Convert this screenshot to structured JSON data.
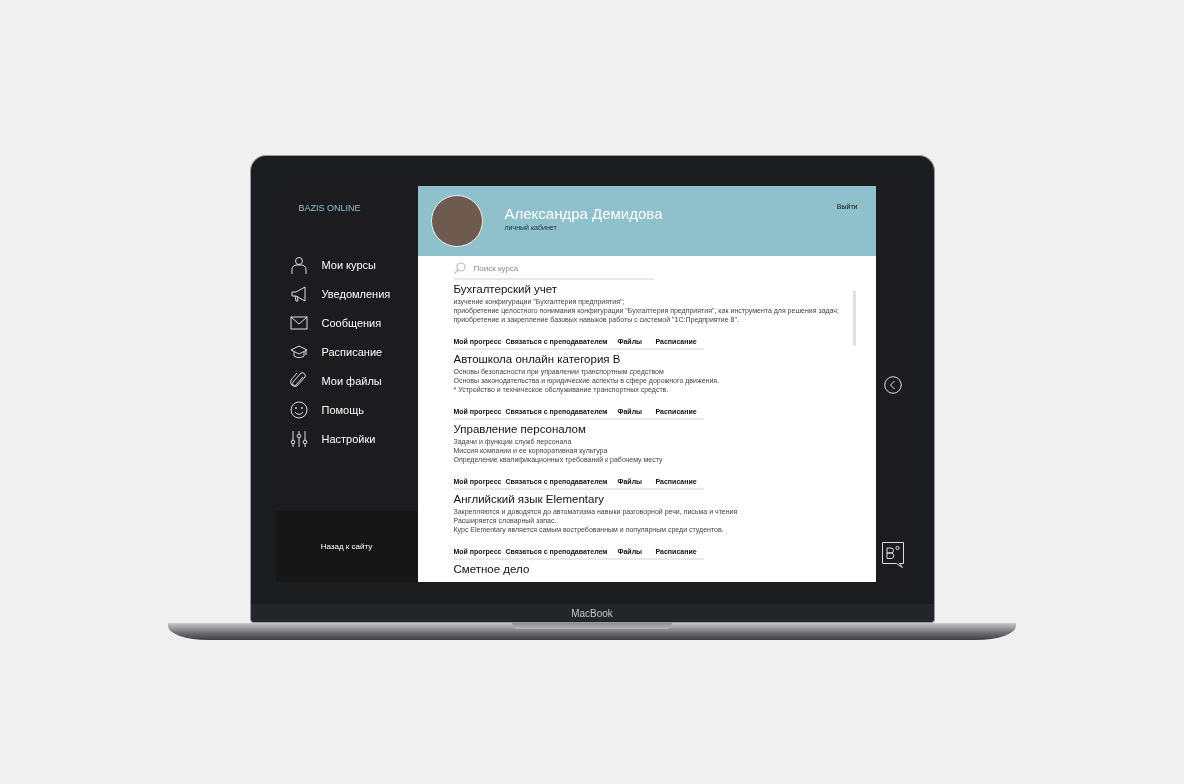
{
  "laptop": {
    "brand": "MacBook"
  },
  "sidebar": {
    "logo": "BAZIS ONLINE",
    "items": [
      {
        "label": "Мои курсы",
        "kind": "person"
      },
      {
        "label": "Уведомления",
        "kind": "megaphone"
      },
      {
        "label": "Сообщения",
        "kind": "envelope"
      },
      {
        "label": "Расписание",
        "kind": "cap"
      },
      {
        "label": "Мои файлы",
        "kind": "clip"
      },
      {
        "label": "Помощь",
        "kind": "smile"
      },
      {
        "label": "Настройки",
        "kind": "sliders"
      }
    ],
    "back_link": "Назад к сайту"
  },
  "header": {
    "name": "Александра Демидова",
    "subtitle": "личный кабинет",
    "logout": "Выйти"
  },
  "search": {
    "placeholder": "Поиск курса"
  },
  "courses": [
    {
      "title": "Бухгалтерский учет",
      "lines": [
        "изучение конфигурации \"Бухгалтерия предприятия\";",
        "приобретение целостного понимания конфигурации \"Бухгалтерия предприятия\", как инструмента для решения задач;",
        "приобретение и закрепление базовых навыков работы с системой \"1С:Предприятие 8\"."
      ],
      "links": [
        "Мой прогресс",
        "Связаться с преподавателем",
        "Файлы",
        "Расписание"
      ]
    },
    {
      "title": "Автошкола онлайн категория В",
      "lines": [
        "Основы безопасности при управлении транспортным средством",
        "Основы законодательства и юридические аспекты в сфере дорожного движения.",
        "* Устройство и техническое обслуживание транспортных средств."
      ],
      "links": [
        "Мой прогресс",
        "Связаться с преподавателем",
        "Файлы",
        "Расписание"
      ]
    },
    {
      "title": "Управление персоналом",
      "lines": [
        "Задачи и функции служб персонала",
        "Миссия компании и ее корпоративная культура",
        "Определение квалификационных требований к рабочему месту"
      ],
      "links": [
        "Мой прогресс",
        "Связаться с преподавателем",
        "Файлы",
        "Расписание"
      ]
    },
    {
      "title": "Английский язык Elementary",
      "lines": [
        "Закрепляются и доводятся до автоматизма навыки разговорной речи, письма и чтения",
        "Расширяется словарный запас.",
        "Курс Elementary является самым востребованным и популярным среди студентов."
      ],
      "links": [
        "Мой прогресс",
        "Связаться с преподавателем",
        "Файлы",
        "Расписание"
      ]
    },
    {
      "title": "Сметное дело"
    }
  ]
}
